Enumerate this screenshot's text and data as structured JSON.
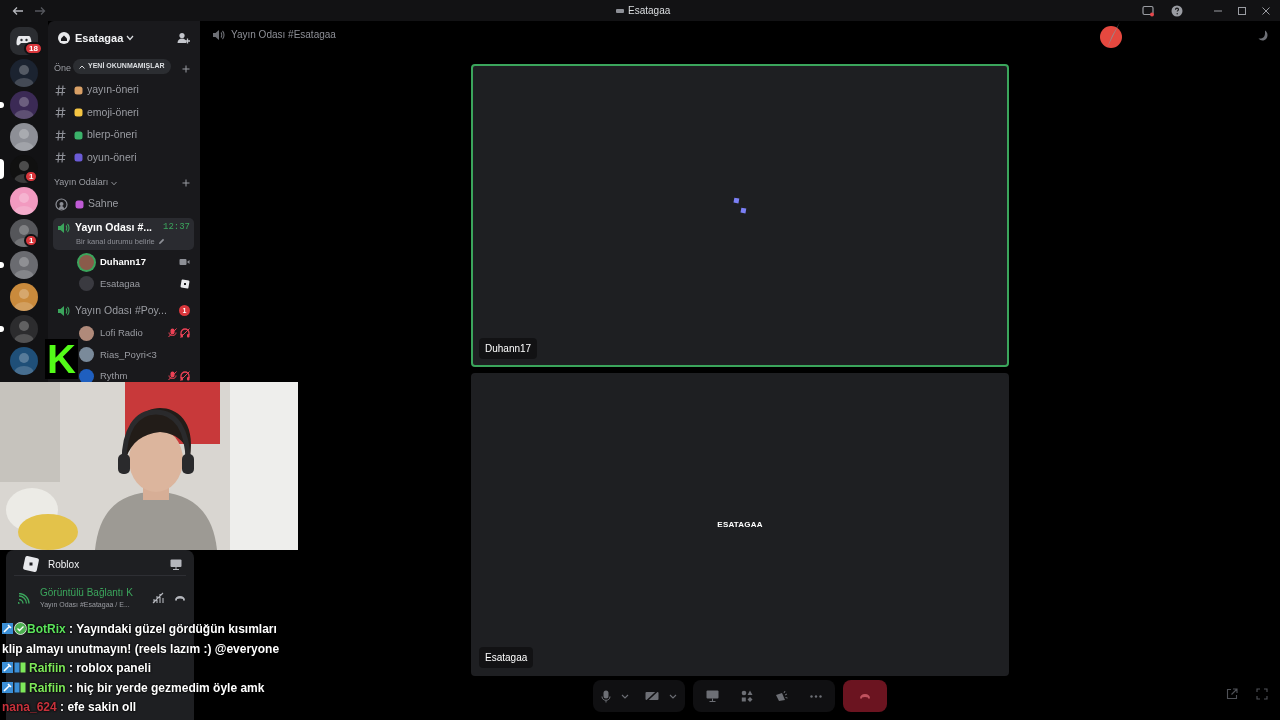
{
  "titlebar": {
    "title": "Esatagaa"
  },
  "servers": [
    {
      "kind": "home",
      "color": "#2b2d31",
      "badge": "18",
      "selected": false,
      "unread": false
    },
    {
      "kind": "server",
      "color": "#1b2330",
      "selected": false,
      "unread": false
    },
    {
      "kind": "server",
      "color": "#3b2a55",
      "selected": false,
      "unread": true
    },
    {
      "kind": "server",
      "color": "#8d8f96",
      "selected": false,
      "unread": false
    },
    {
      "kind": "server",
      "color": "#101010",
      "badge": "1",
      "selected": true
    },
    {
      "kind": "server",
      "color": "#f29ac0",
      "selected": false,
      "unread": false
    },
    {
      "kind": "server",
      "color": "#55565a",
      "badge": "1",
      "selected": false,
      "unread": false
    },
    {
      "kind": "server",
      "color": "#6a6b70",
      "selected": false,
      "unread": true
    },
    {
      "kind": "server",
      "color": "#c98a3c",
      "selected": false,
      "unread": false
    },
    {
      "kind": "server",
      "color": "#2c2c2e",
      "selected": false,
      "unread": true
    },
    {
      "kind": "server",
      "color": "#1f4f78",
      "selected": false,
      "unread": false
    }
  ],
  "sidebar": {
    "server_name": "Esatagaa",
    "unread_pill": "YENİ OKUNMAMIŞLAR",
    "categories": [
      {
        "name": "Öne",
        "channels": [
          {
            "kind": "text",
            "name": "yayın-öneri",
            "color": "#d9a066"
          },
          {
            "kind": "text",
            "name": "emoji-öneri",
            "color": "#f5c542"
          },
          {
            "kind": "text",
            "name": "blerp-öneri",
            "color": "#3bb26a"
          },
          {
            "kind": "text",
            "name": "oyun-öneri",
            "color": "#6b5bd6"
          }
        ]
      },
      {
        "name": "Yayın Odaları",
        "expanded": true,
        "channels": [
          {
            "kind": "stage",
            "name": "Sahne",
            "color": "#c05bd6"
          },
          {
            "kind": "voice",
            "name": "Yayın Odası #...",
            "selected": true,
            "time": "12:37",
            "status": "Bir kanal durumu belirle",
            "members": [
              {
                "name": "Duhann17",
                "speaking": true,
                "kind": "video",
                "color": "#8a5a4a"
              },
              {
                "name": "Esatagaa",
                "speaking": false,
                "kind": "game",
                "color": "#3a3a40"
              }
            ]
          },
          {
            "kind": "voice",
            "name": "Yayın Odası #Poy...",
            "selected": false,
            "badge": "1",
            "members": [
              {
                "name": "Lofi Radio",
                "speaking": false,
                "kind": "muted",
                "color": "#b08a7a"
              },
              {
                "name": "Rias_Poyri<3",
                "speaking": false,
                "kind": "plain",
                "color": "#7a8a9a"
              },
              {
                "name": "Rythm",
                "speaking": false,
                "kind": "muted",
                "color": "#1f5fbf"
              }
            ]
          }
        ]
      }
    ]
  },
  "panel": {
    "activity": "Roblox",
    "voice_status": "Görüntülü Bağlantı K",
    "voice_channel": "Yayın Odası #Esatagaa / E..."
  },
  "main": {
    "channel_title": "Yayın Odası #Esatagaa",
    "tiles": [
      {
        "name": "Duhann17",
        "speaking": true,
        "kind": "loading"
      },
      {
        "name": "Esatagaa",
        "speaking": false,
        "kind": "label",
        "label": "ESATAGAA"
      }
    ],
    "controls": {
      "mic_muted": false,
      "camera_off": true
    }
  },
  "overlay": {
    "logo": "K",
    "chat": [
      {
        "user": "BotRix",
        "color": "#5be35b",
        "bot": true,
        "separator": ":",
        "text": "Yayındaki güzel gördüğün kısımları klip almayı unutmayın! (reels lazım :) @everyone"
      },
      {
        "user": "Raifiin",
        "color": "#7ee85a",
        "bot": false,
        "separator": ":",
        "text": "roblox paneli"
      },
      {
        "user": "Raifiin",
        "color": "#7ee85a",
        "bot": false,
        "separator": ":",
        "text": "hiç bir yerde gezmedim öyle amk"
      },
      {
        "user": "nana_624",
        "color": "#c8323c",
        "bot": false,
        "separator": ":",
        "text": "efe sakin oll"
      }
    ]
  }
}
